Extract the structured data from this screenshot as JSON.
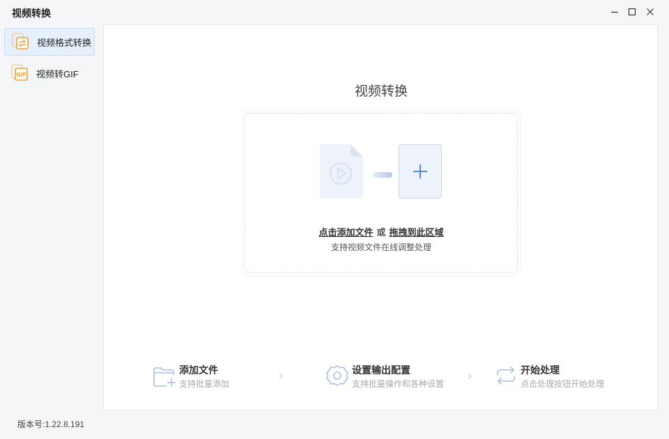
{
  "app": {
    "title": "视频转换"
  },
  "window_controls": {
    "minimize_icon": "minimize-icon",
    "maximize_icon": "maximize-icon",
    "close_icon": "close-icon"
  },
  "sidebar": {
    "items": [
      {
        "label": "视频格式转换",
        "icon": "video-convert-icon",
        "active": true
      },
      {
        "label": "视频转GIF",
        "icon": "gif-icon",
        "active": false
      }
    ]
  },
  "main": {
    "title": "视频转换",
    "drop_zone": {
      "click_add": "点击添加文件",
      "or": "或",
      "drag_here": "拖拽到此区域",
      "subtitle": "支持视频文件在线调整处理"
    },
    "steps": [
      {
        "title": "添加文件",
        "desc": "支持批量添加",
        "icon": "add-folder-icon"
      },
      {
        "title": "设置输出配置",
        "desc": "支持批量操作和各种设置",
        "icon": "settings-gear-icon"
      },
      {
        "title": "开始处理",
        "desc": "点击处理按钮开始处理",
        "icon": "repeat-icon"
      }
    ]
  },
  "footer": {
    "version": "版本号:1.22.8.191"
  },
  "colors": {
    "accent": "#3a7be0",
    "orange": "#f0a030",
    "active_bg": "#e6effc"
  }
}
